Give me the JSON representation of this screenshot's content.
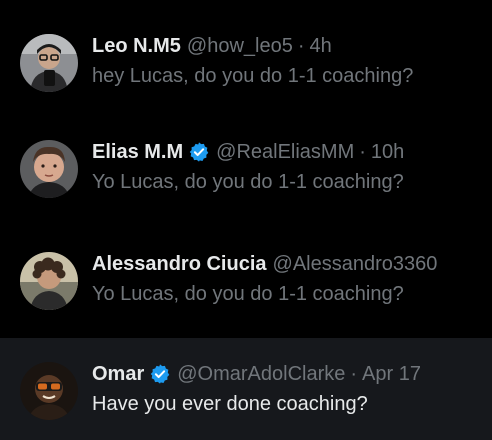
{
  "conversations": [
    {
      "name": "Leo N.M5",
      "handle": "@how_leo5",
      "separator": "·",
      "time": "4h",
      "verified": false,
      "preview": "hey Lucas, do you do 1-1 coaching?",
      "avatar_icon": "person-glasses-avatar"
    },
    {
      "name": "Elias M.M",
      "handle": "@RealEliasMM",
      "separator": "·",
      "time": "10h",
      "verified": true,
      "preview": "Yo Lucas, do you do 1-1 coaching?",
      "avatar_icon": "person-portrait-avatar"
    },
    {
      "name": "Alessandro Ciucia",
      "handle": "@Alessandro3360",
      "separator": "·",
      "time": "",
      "verified": false,
      "preview": "Yo Lucas, do you do 1-1 coaching?",
      "avatar_icon": "person-curly-hair-avatar"
    },
    {
      "name": "Omar",
      "handle": "@OmarAdolClarke",
      "separator": "·",
      "time": "Apr 17",
      "verified": true,
      "preview": "Have you ever done coaching?",
      "avatar_icon": "person-dark-avatar"
    }
  ],
  "colors": {
    "background": "#000000",
    "highlight_row": "#16181c",
    "primary_text": "#e7e9ea",
    "secondary_text": "#71767b",
    "verified_badge": "#1d9bf0"
  }
}
